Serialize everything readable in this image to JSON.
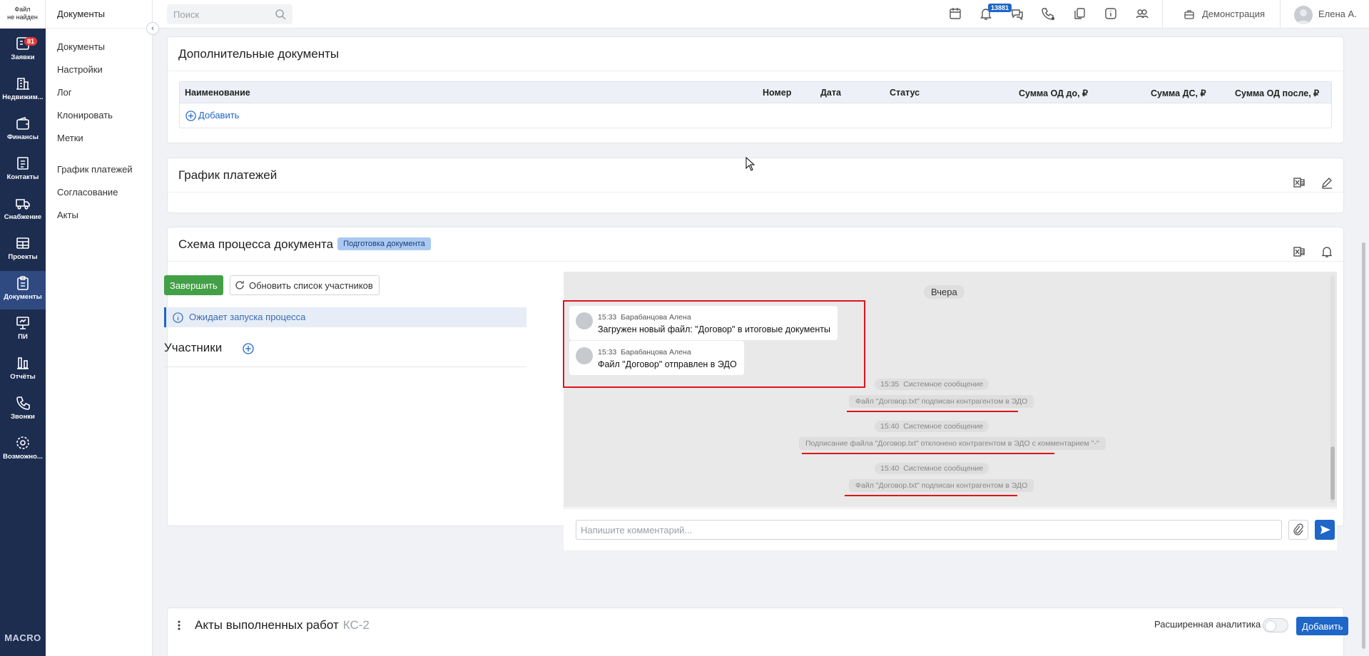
{
  "nav": {
    "logo_line1": "Файл",
    "logo_line2": "не найден",
    "items": [
      {
        "label": "Заявки",
        "badge": "81",
        "icon": "requests-icon"
      },
      {
        "label": "Недвижим...",
        "icon": "building-icon"
      },
      {
        "label": "Финансы",
        "icon": "wallet-icon"
      },
      {
        "label": "Контакты",
        "icon": "contacts-icon"
      },
      {
        "label": "Снабжение",
        "icon": "truck-icon"
      },
      {
        "label": "Проекты",
        "icon": "projects-icon"
      },
      {
        "label": "Документы",
        "icon": "clipboard-icon",
        "active": true
      },
      {
        "label": "ПИ",
        "icon": "presentation-icon"
      },
      {
        "label": "Отчёты",
        "icon": "reports-icon"
      },
      {
        "label": "Звонки",
        "icon": "phone-icon"
      },
      {
        "label": "Возможно...",
        "icon": "settings-icon"
      }
    ],
    "brand": "MACRO"
  },
  "subnav": {
    "title": "Документы",
    "group1": [
      "Документы",
      "Настройки",
      "Лог",
      "Клонировать",
      "Метки"
    ],
    "group2": [
      "График платежей",
      "Согласование",
      "Акты"
    ]
  },
  "topbar": {
    "search_placeholder": "Поиск",
    "notifications_badge": "13881",
    "demo_label": "Демонстрация",
    "user_name": "Елена А."
  },
  "additional_docs": {
    "title": "Дополнительные документы",
    "columns": [
      "Наименование",
      "Номер",
      "Дата",
      "Статус",
      "Сумма ОД до, ₽",
      "Сумма ДС, ₽",
      "Сумма ОД после, ₽"
    ],
    "add_label": "Добавить"
  },
  "payment_schedule": {
    "title": "График платежей"
  },
  "process_scheme": {
    "title": "Схема процесса документа",
    "status": "Подготовка документа",
    "finish_label": "Завершить",
    "refresh_label": "Обновить список участников",
    "info_text": "Ожидает запуска процесса",
    "participants_label": "Участники"
  },
  "chat": {
    "day": "Вчера",
    "messages": [
      {
        "time": "15:33",
        "author": "Барабанцова Алена",
        "text": "Загружен новый файл: \"Договор\" в итоговые документы"
      },
      {
        "time": "15:33",
        "author": "Барабанцова Алена",
        "text": "Файл \"Договор\" отправлен в ЭДО"
      }
    ],
    "system_messages": [
      {
        "time": "15:35",
        "author": "Системное сообщение",
        "text": "Файл \"Договор.txt\" подписан контрагентом в ЭДО"
      },
      {
        "time": "15:40",
        "author": "Системное сообщение",
        "text": "Подписание файла \"Договор.txt\" отклонено контрагентом в ЭДО с комментарием \"-\""
      },
      {
        "time": "15:40",
        "author": "Системное сообщение",
        "text": "Файл \"Договор.txt\" подписан контрагентом в ЭДО"
      }
    ],
    "comment_placeholder": "Напишите комментарий..."
  },
  "acts": {
    "title": "Акты выполненных работ",
    "subtitle": "КС-2",
    "analytics_label": "Расширенная аналитика",
    "add_label": "Добавить"
  },
  "colors": {
    "nav_bg": "#1d2d50",
    "accent": "#1e66c7",
    "green": "#43a047",
    "highlight_red": "#e0141b"
  }
}
